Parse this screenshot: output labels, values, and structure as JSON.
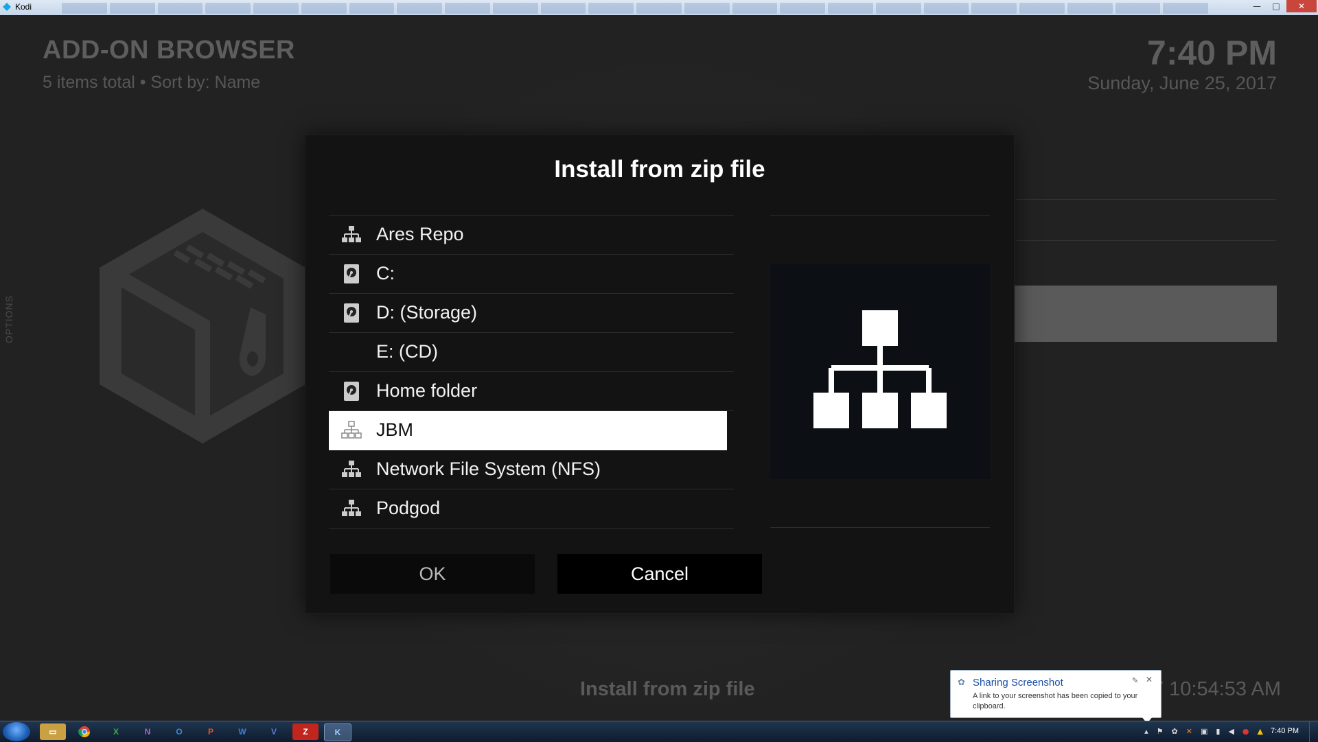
{
  "window": {
    "title": "Kodi",
    "controls": {
      "minimize": "—",
      "maximize": "□",
      "close": "✕"
    }
  },
  "header": {
    "title": "ADD-ON BROWSER",
    "subtitle": "5 items total • Sort by: Name",
    "time": "7:40 PM",
    "date": "Sunday, June 25, 2017"
  },
  "sidebar": {
    "options_label": "OPTIONS"
  },
  "background": {
    "footer_label": "Install from zip file",
    "footer_time": "7 10:54:53 AM"
  },
  "dialog": {
    "title": "Install from zip file",
    "items": [
      {
        "label": "Ares Repo",
        "icon": "network-icon"
      },
      {
        "label": "C:",
        "icon": "hard-drive-icon"
      },
      {
        "label": "D: (Storage)",
        "icon": "hard-drive-icon"
      },
      {
        "label": "E: (CD)",
        "icon": ""
      },
      {
        "label": "Home folder",
        "icon": "hard-drive-icon"
      },
      {
        "label": "JBM",
        "icon": "network-icon",
        "selected": true
      },
      {
        "label": "Network File System (NFS)",
        "icon": "network-icon"
      },
      {
        "label": "Podgod",
        "icon": "network-icon"
      }
    ],
    "preview_icon": "network-icon",
    "ok_label": "OK",
    "cancel_label": "Cancel"
  },
  "notification": {
    "title": "Sharing Screenshot",
    "body": "A link to your screenshot has been copied to your clipboard."
  },
  "taskbar": {
    "apps": [
      {
        "name": "file-explorer",
        "glyph": "▭"
      },
      {
        "name": "chrome",
        "glyph": "◉"
      },
      {
        "name": "excel",
        "glyph": "X"
      },
      {
        "name": "onenote",
        "glyph": "N"
      },
      {
        "name": "outlook",
        "glyph": "O"
      },
      {
        "name": "powerpoint",
        "glyph": "P"
      },
      {
        "name": "word",
        "glyph": "W"
      },
      {
        "name": "visio",
        "glyph": "V"
      },
      {
        "name": "filezilla",
        "glyph": "Z"
      },
      {
        "name": "kodi",
        "glyph": "K",
        "active": true
      }
    ],
    "clock": "7:40 PM"
  },
  "colors": {
    "accent_selected": "#ffffff",
    "dialog_bg": "#131313",
    "notification_title": "#1a4fa3"
  }
}
